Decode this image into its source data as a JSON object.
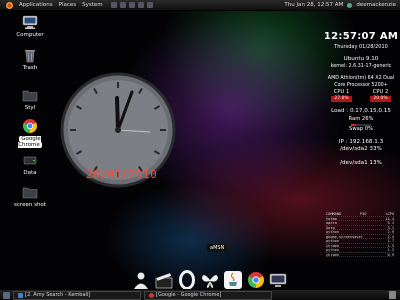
{
  "top_panel": {
    "menus": [
      "Applications",
      "Places",
      "System"
    ],
    "datetime": "Thu Jan 28, 12:57 AM",
    "username": "deemackenzie"
  },
  "desktop_icons": [
    {
      "label": "Computer",
      "icon": "computer-icon"
    },
    {
      "label": "Trash",
      "icon": "trash-icon"
    },
    {
      "label": "Styl",
      "icon": "folder-icon"
    },
    {
      "label": "Google Chrome",
      "icon": "chrome-icon"
    },
    {
      "label": "Data",
      "icon": "drive-icon"
    },
    {
      "label": "screen shot",
      "icon": "folder-icon"
    }
  ],
  "clock": {
    "date_overlay": "28/01/2010"
  },
  "sysinfo": {
    "time": "12:57:07 AM",
    "date": "Thursday 01/28/2010",
    "os": "Ubuntu 9.10",
    "kernel": "kernel: 2.6.31-17-generic",
    "cpu_model": "AMD Athlon(tm) 64 X2 Dual Core Processor 5200+",
    "cpu1_label": "CPU 1",
    "cpu2_label": "CPU 2",
    "cpu1_value": "27.0%",
    "cpu2_value": "20.0%",
    "load": "Load : 0.17,0.15,0.15",
    "ram": "Ram 26%",
    "swap": "Swap 0%",
    "ip": "IP : 192.168.1.3",
    "sda2": "/dev/sda2 33%",
    "sda1": "/dev/sda1 13%",
    "ram_fraction": 0.26,
    "swap_fraction": 0.0
  },
  "process_table": {
    "header": [
      "COMMAND",
      "PID",
      "%CPU"
    ],
    "rows": [
      [
        "totem",
        "",
        "14.4"
      ],
      [
        "opera",
        "",
        "5.1"
      ],
      [
        "Xorg",
        "",
        "3.1"
      ],
      [
        "python",
        "",
        "2.9"
      ],
      [
        "gnome-screensaver",
        "",
        "2.4"
      ],
      [
        "python",
        "",
        "1.7"
      ],
      [
        "chrome",
        "",
        "1.5"
      ],
      [
        "python",
        "",
        "1.2"
      ],
      [
        "chrome",
        "",
        "0.9"
      ]
    ]
  },
  "dock": {
    "label": "aMSN",
    "items": [
      "amsn-icon",
      "clapper-icon",
      "opera-icon",
      "butterfly-icon",
      "java-icon",
      "chrome-icon",
      "monitor-icon"
    ]
  },
  "bottom_panel": {
    "tasks": [
      {
        "label": "[2. Amy Search - Kembali]",
        "icon": "search-icon"
      },
      {
        "label": "[Google - Google Chrome]",
        "icon": "chrome-icon"
      }
    ]
  }
}
